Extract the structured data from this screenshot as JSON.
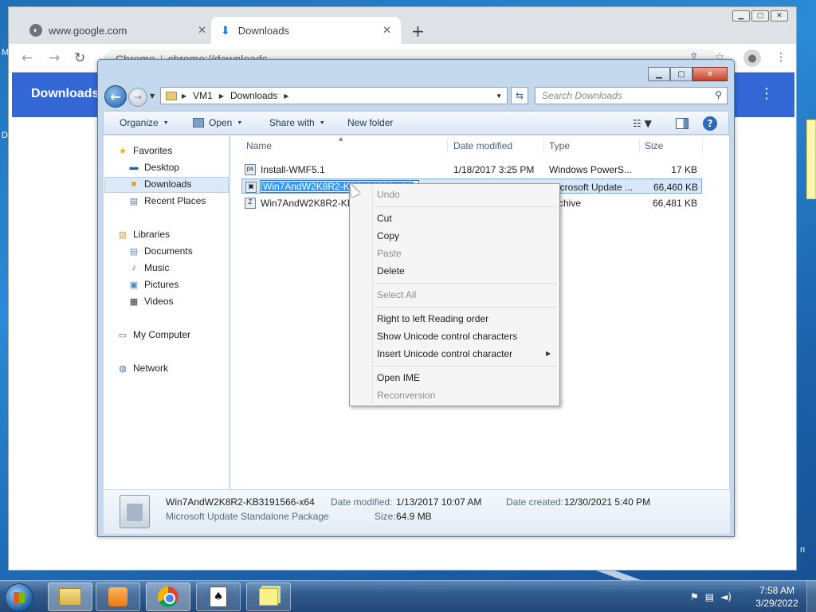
{
  "desktop": {
    "frag_left1": "M",
    "frag_left2": "D",
    "frag_right": "n"
  },
  "chrome": {
    "tabs": [
      {
        "label": "www.google.com",
        "close": "✕"
      },
      {
        "label": "Downloads",
        "close": "✕"
      }
    ],
    "new_tab": "+",
    "window_controls": [
      "▁",
      "▢",
      "✕"
    ],
    "omnibox": {
      "site": "Chrome",
      "url": "chrome://downloads"
    },
    "header_title": "Downloads",
    "menu": "⋮"
  },
  "explorer": {
    "title_controls": {
      "min": "▁",
      "max": "▢",
      "close": "✕"
    },
    "breadcrumb": [
      "VM1",
      "Downloads"
    ],
    "search_placeholder": "Search Downloads",
    "toolbar": {
      "organize": "Organize",
      "open": "Open",
      "share_with": "Share with",
      "new_folder": "New folder"
    },
    "nav": {
      "favorites": "Favorites",
      "desktop": "Desktop",
      "downloads": "Downloads",
      "recent_places": "Recent Places",
      "libraries": "Libraries",
      "documents": "Documents",
      "music": "Music",
      "pictures": "Pictures",
      "videos": "Videos",
      "my_computer": "My Computer",
      "network": "Network"
    },
    "columns": {
      "name": "Name",
      "date_modified": "Date modified",
      "type": "Type",
      "size": "Size"
    },
    "files": [
      {
        "name": "Install-WMF5.1",
        "date": "1/18/2017 3:25 PM",
        "type": "Windows PowerS...",
        "size": "17 KB"
      },
      {
        "name": "Win7AndW2K8R2-KB3191566-x64",
        "name_visible": "Win7AndW2K8R2-KB3191566-x64",
        "date": "",
        "type": "Microsoft Update ...",
        "size": "66,460 KB"
      },
      {
        "name": "Win7AndW2K8R2-KB",
        "date": "",
        "type": "Archive",
        "size": "66,481 KB"
      }
    ],
    "details": {
      "name": "Win7AndW2K8R2-KB3191566-x64",
      "type": "Microsoft Update Standalone Package",
      "date_modified_label": "Date modified:",
      "date_modified": "1/13/2017 10:07 AM",
      "size_label": "Size:",
      "size": "64.9 MB",
      "date_created_label": "Date created:",
      "date_created": "12/30/2021 5:40 PM"
    }
  },
  "context_menu": {
    "undo": "Undo",
    "cut": "Cut",
    "copy": "Copy",
    "paste": "Paste",
    "delete": "Delete",
    "select_all": "Select All",
    "rtl": "Right to left Reading order",
    "show_unicode": "Show Unicode control characters",
    "insert_unicode": "Insert Unicode control character",
    "open_ime": "Open IME",
    "reconversion": "Reconversion"
  },
  "taskbar": {
    "clock_time": "7:58 AM",
    "clock_date": "3/29/2022"
  }
}
